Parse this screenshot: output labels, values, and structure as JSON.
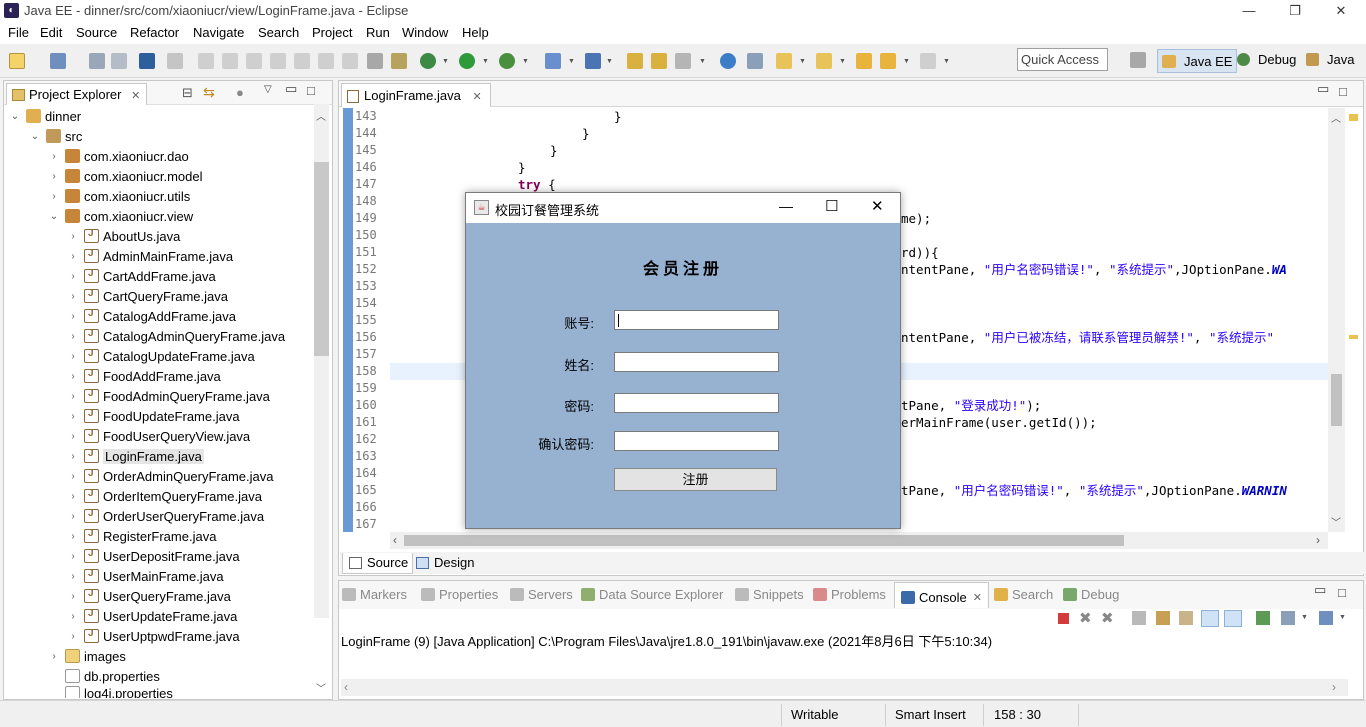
{
  "window": {
    "title": "Java EE - dinner/src/com/xiaoniucr/view/LoginFrame.java - Eclipse"
  },
  "menu": [
    "File",
    "Edit",
    "Source",
    "Refactor",
    "Navigate",
    "Search",
    "Project",
    "Run",
    "Window",
    "Help"
  ],
  "toolbar": {
    "quick_access": "Quick Access",
    "perspectives": [
      "Java EE",
      "Debug",
      "Java"
    ]
  },
  "explorer": {
    "tab": "Project Explorer",
    "project": "dinner",
    "src": "src",
    "packages": [
      "com.xiaoniucr.dao",
      "com.xiaoniucr.model",
      "com.xiaoniucr.utils",
      "com.xiaoniucr.view"
    ],
    "files": [
      "AboutUs.java",
      "AdminMainFrame.java",
      "CartAddFrame.java",
      "CartQueryFrame.java",
      "CatalogAddFrame.java",
      "CatalogAdminQueryFrame.java",
      "CatalogUpdateFrame.java",
      "FoodAddFrame.java",
      "FoodAdminQueryFrame.java",
      "FoodUpdateFrame.java",
      "FoodUserQueryView.java",
      "LoginFrame.java",
      "OrderAdminQueryFrame.java",
      "OrderItemQueryFrame.java",
      "OrderUserQueryFrame.java",
      "RegisterFrame.java",
      "UserDepositFrame.java",
      "UserMainFrame.java",
      "UserQueryFrame.java",
      "UserUpdateFrame.java",
      "UserUptpwdFrame.java"
    ],
    "selected": "LoginFrame.java",
    "others": [
      "images",
      "db.properties",
      "log4j.properties"
    ]
  },
  "editor": {
    "tab": "LoginFrame.java",
    "line_numbers": [
      "143",
      "144",
      "145",
      "146",
      "147",
      "148",
      "149",
      "150",
      "151",
      "152",
      "153",
      "154",
      "155",
      "156",
      "157",
      "158",
      "159",
      "160",
      "161",
      "162",
      "163",
      "164",
      "165",
      "166",
      "167"
    ],
    "lines": {
      "l143": "}",
      "l144": "}",
      "l145": "}",
      "l146": "}",
      "l147_kw": "try",
      "l147_rest": " {",
      "l149": "me);",
      "l151": "rd)){",
      "l152_a": "ntentPane, ",
      "l152_s1": "\"用户名密码错误!\"",
      "l152_b": ", ",
      "l152_s2": "\"系统提示\"",
      "l152_c": ",JOptionPane.",
      "l152_d": "WA",
      "l156_a": "ntentPane, ",
      "l156_s1": "\"用户已被冻结，请联系管理员解禁!\"",
      "l156_b": ", ",
      "l156_s2": "\"系统提示\"",
      "l160_a": "tPane, ",
      "l160_s1": "\"登录成功!\"",
      "l160_b": ");",
      "l161": "erMainFrame(user.getId());",
      "l165_a": "tPane, ",
      "l165_s1": "\"用户名密码错误!\"",
      "l165_b": ", ",
      "l165_s2": "\"系统提示\"",
      "l165_c": ",JOptionPane.",
      "l165_d": "WARNIN"
    },
    "bottom_tabs": [
      "Source",
      "Design"
    ]
  },
  "console": {
    "tabs": [
      "Markers",
      "Properties",
      "Servers",
      "Data Source Explorer",
      "Snippets",
      "Problems",
      "Console",
      "Search",
      "Debug"
    ],
    "active": "Console",
    "text": "LoginFrame (9) [Java Application] C:\\Program Files\\Java\\jre1.8.0_191\\bin\\javaw.exe (2021年8月6日 下午5:10:34)"
  },
  "status": {
    "writable": "Writable",
    "insert": "Smart Insert",
    "position": "158 : 30"
  },
  "dialog": {
    "title": "校园订餐管理系统",
    "heading": "会员注册",
    "account_label": "账号:",
    "name_label": "姓名:",
    "password_label": "密码:",
    "confirm_label": "确认密码:",
    "register_button": "注册",
    "colors": {
      "body": "#97b1d1"
    }
  }
}
